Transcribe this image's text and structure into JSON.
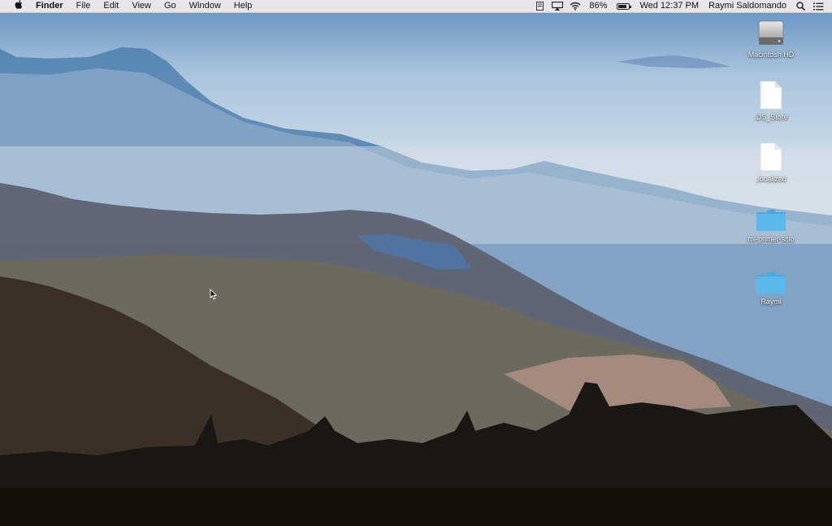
{
  "menubar": {
    "apple": "",
    "app_name": "Finder",
    "menus": [
      "File",
      "Edit",
      "View",
      "Go",
      "Window",
      "Help"
    ],
    "battery_percent": "86%",
    "battery_level": 0.86,
    "clock": "Wed 12:37 PM",
    "user": "Raymi Saldomando",
    "icons": [
      "apple-icon",
      "notes-icon",
      "airplay-icon",
      "wifi-icon",
      "battery-icon",
      "spotlight-icon",
      "notification-center-icon"
    ]
  },
  "desktop": {
    "icons": [
      {
        "label": "Macintosh HD",
        "type": "hard-drive-icon"
      },
      {
        "label": ".DS_Store",
        "type": "file-icon"
      },
      {
        "label": ".localized",
        "type": "file-icon"
      },
      {
        "label": "mi-primer-sitio",
        "type": "folder-icon"
      },
      {
        "label": "Raymi",
        "type": "folder-icon"
      }
    ]
  },
  "colors": {
    "folder": "#5ab8ea",
    "sky_top": "#5f8fbf",
    "haze": "#dfe6ea",
    "forest_dark": "#1a1712"
  }
}
